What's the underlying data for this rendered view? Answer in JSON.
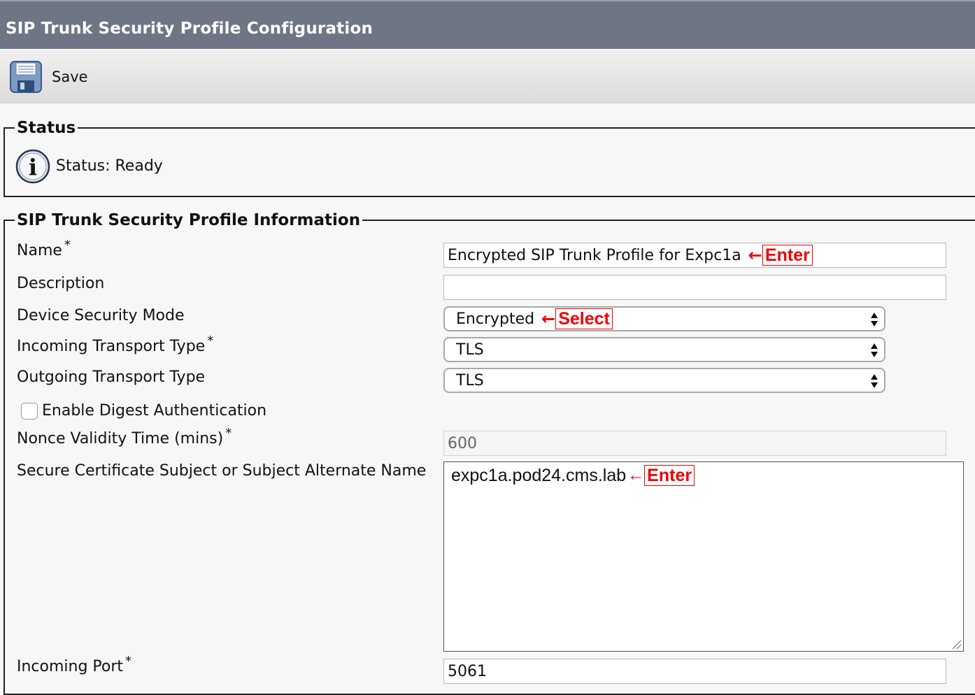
{
  "page": {
    "title": "SIP Trunk Security Profile Configuration"
  },
  "toolbar": {
    "save_label": "Save",
    "save_icon": "floppy-disk-icon"
  },
  "status": {
    "legend": "Status",
    "text": "Status: Ready",
    "icon": "info-icon"
  },
  "info": {
    "legend": "SIP Trunk Security Profile Information",
    "required_mark": "*",
    "name": {
      "label": "Name",
      "value": "Encrypted SIP Trunk Profile for Expc1a",
      "annotation": "Enter"
    },
    "description": {
      "label": "Description",
      "value": ""
    },
    "device_security_mode": {
      "label": "Device Security Mode",
      "value": "Encrypted",
      "annotation": "Select"
    },
    "incoming_transport": {
      "label": "Incoming Transport Type",
      "value": "TLS"
    },
    "outgoing_transport": {
      "label": "Outgoing Transport Type",
      "value": "TLS"
    },
    "digest_auth": {
      "label": "Enable Digest Authentication",
      "checked": false
    },
    "nonce_validity": {
      "label": "Nonce Validity Time (mins)",
      "value": "600"
    },
    "secure_cert": {
      "label": "Secure Certificate Subject or Subject Alternate Name",
      "value": "expc1a.pod24.cms.lab",
      "annotation": "Enter"
    },
    "incoming_port": {
      "label": "Incoming Port",
      "value": "5061"
    }
  },
  "annotation_arrow": "←",
  "colors": {
    "titlebar": "#6e7686",
    "annotation": "#e00000"
  }
}
